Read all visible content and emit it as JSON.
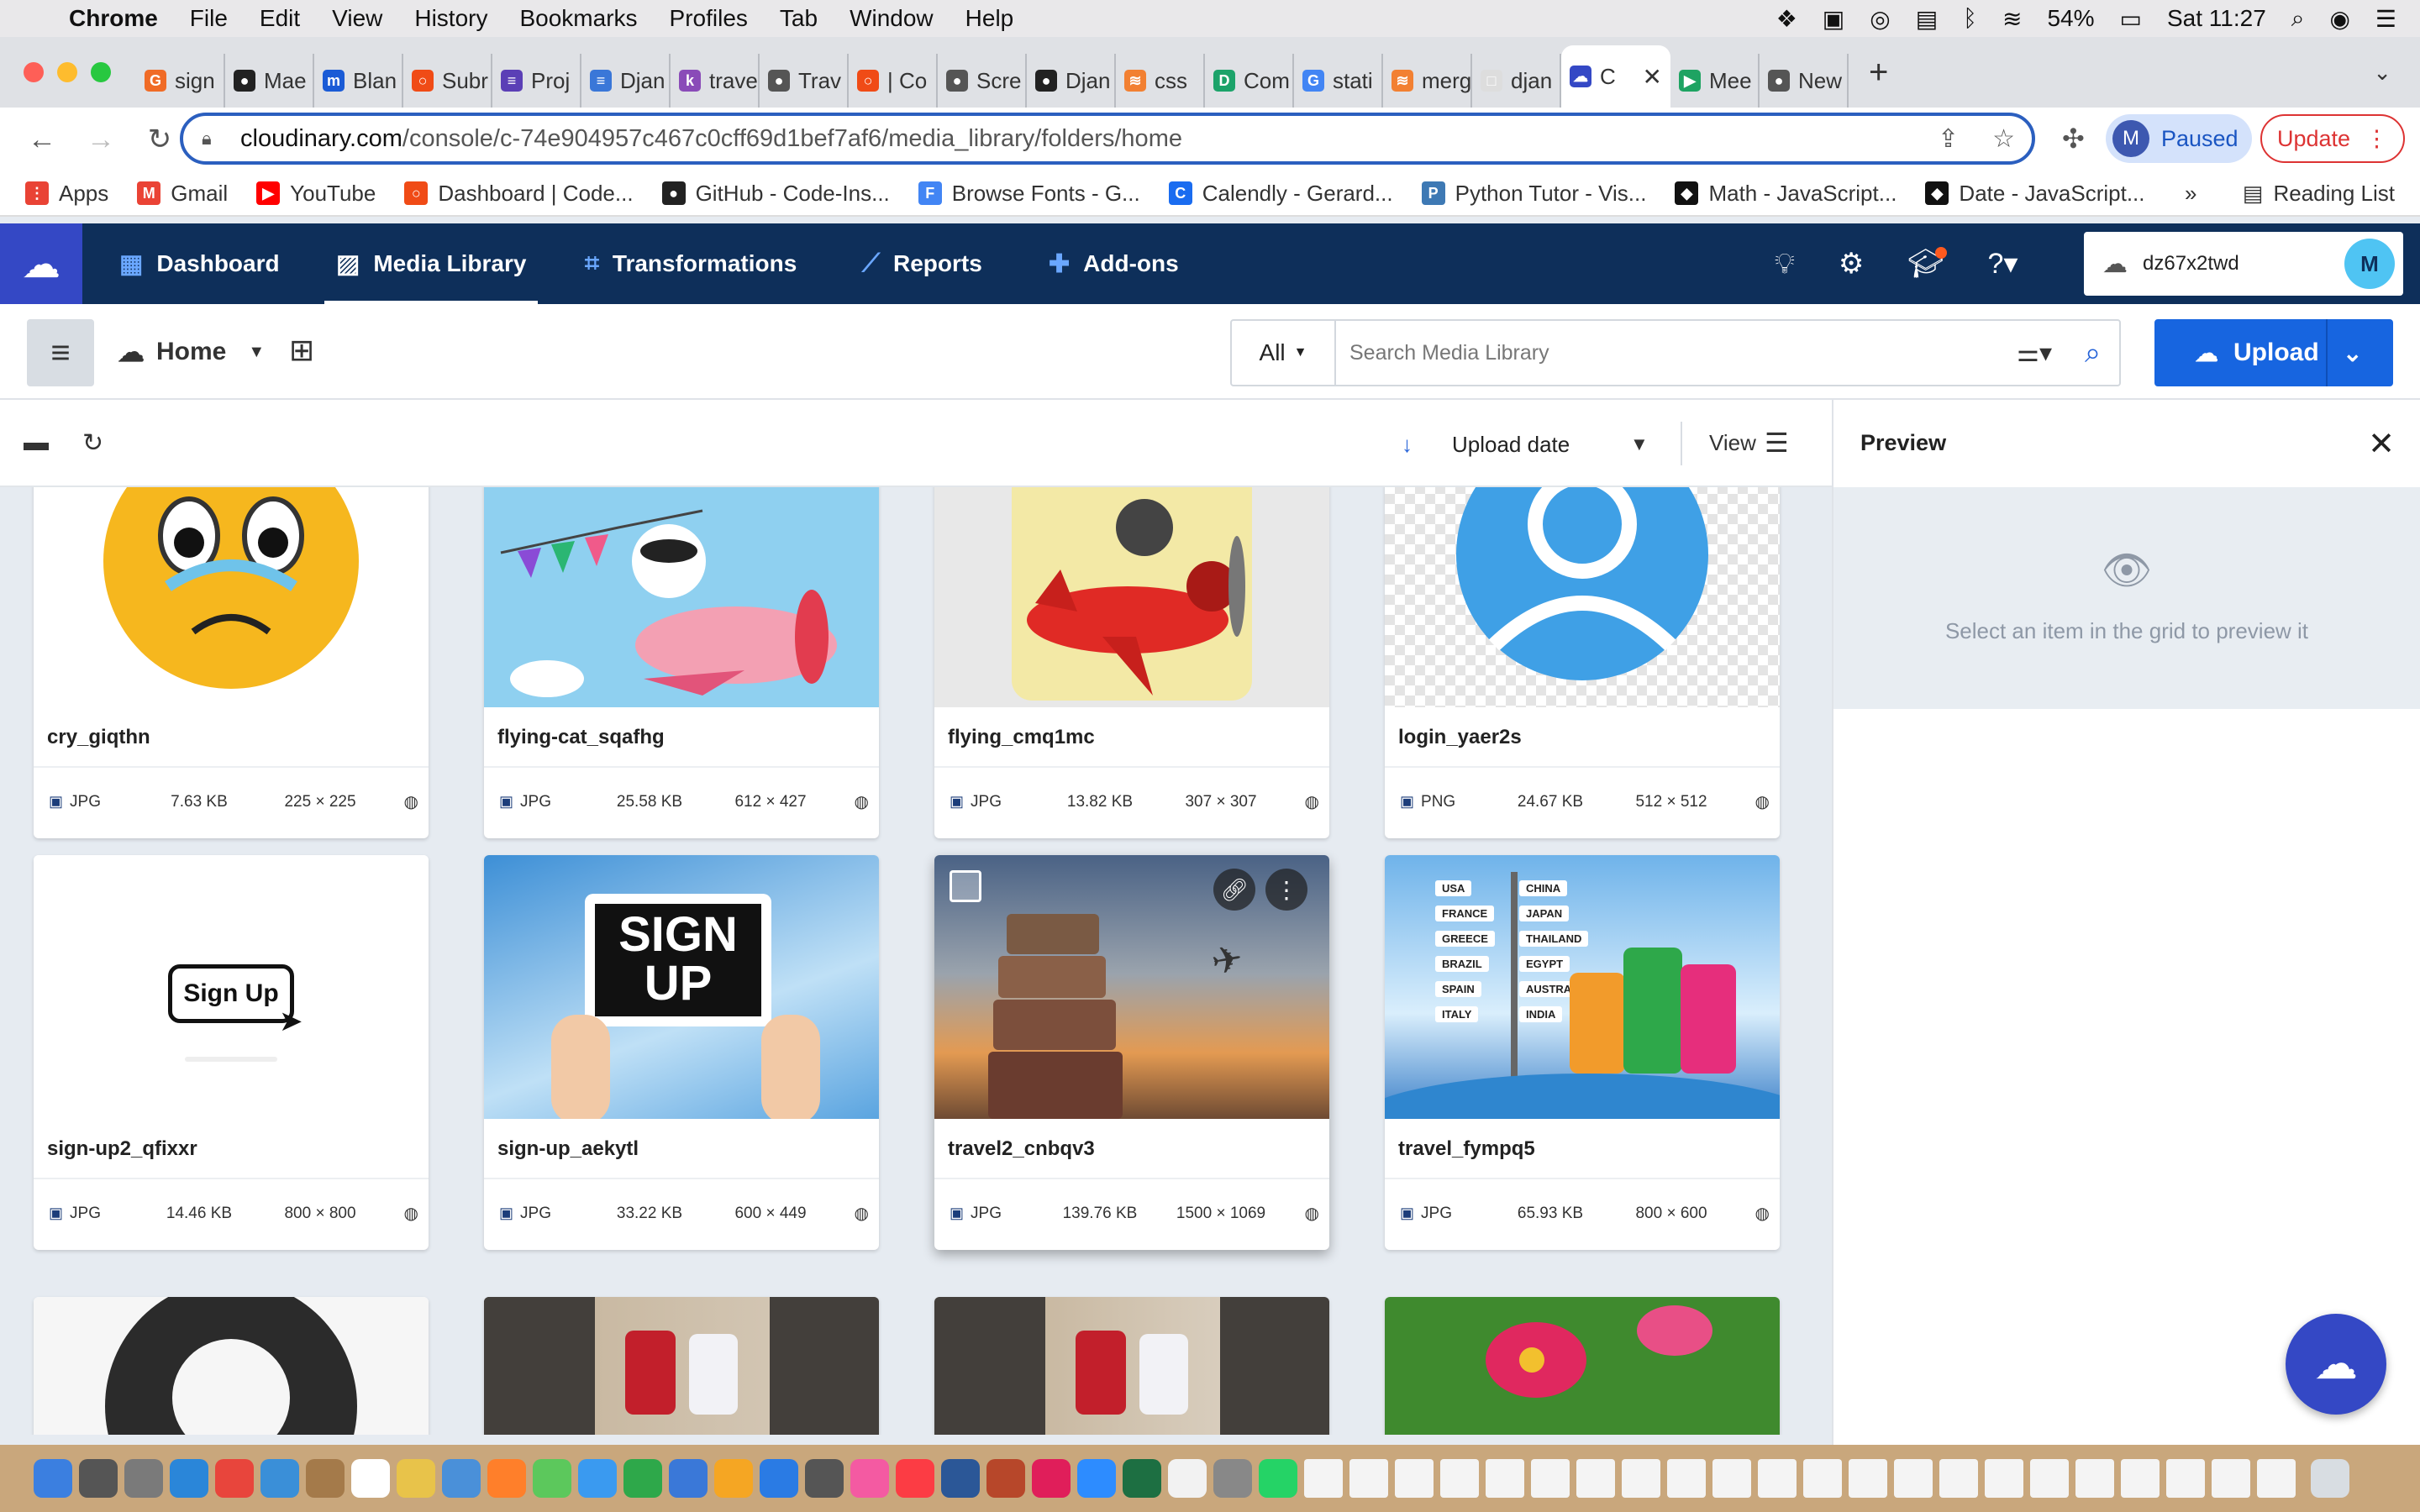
{
  "menubar": {
    "apple": "",
    "app": "Chrome",
    "items": [
      "File",
      "Edit",
      "View",
      "History",
      "Bookmarks",
      "Profiles",
      "Tab",
      "Window",
      "Help"
    ],
    "battery": "54%",
    "clock": "Sat 11:27"
  },
  "tabs": [
    {
      "label": "sign",
      "color": "#f06b26",
      "glyph": "G"
    },
    {
      "label": "Mae",
      "color": "#222222",
      "glyph": "●"
    },
    {
      "label": "Blan",
      "color": "#1a5bd6",
      "glyph": "m"
    },
    {
      "label": "Subr",
      "color": "#f04b16",
      "glyph": "○"
    },
    {
      "label": "Proj",
      "color": "#5b3fb6",
      "glyph": "≡"
    },
    {
      "label": "Djan",
      "color": "#3a77d8",
      "glyph": "≡"
    },
    {
      "label": "trave",
      "color": "#8a4bb8",
      "glyph": "k"
    },
    {
      "label": "Trav",
      "color": "#555555",
      "glyph": "●"
    },
    {
      "label": "| Co",
      "color": "#f04b16",
      "glyph": "○"
    },
    {
      "label": "Scre",
      "color": "#555555",
      "glyph": "●"
    },
    {
      "label": "Djan",
      "color": "#222222",
      "glyph": "●"
    },
    {
      "label": "css",
      "color": "#f28032",
      "glyph": "≋"
    },
    {
      "label": "Com",
      "color": "#1ca36a",
      "glyph": "D"
    },
    {
      "label": "stati",
      "color": "#4285f4",
      "glyph": "G"
    },
    {
      "label": "merg",
      "color": "#f28032",
      "glyph": "≋"
    },
    {
      "label": "djan",
      "color": "#dddddd",
      "glyph": "□"
    },
    {
      "label": "C",
      "color": "#3448c5",
      "glyph": "☁",
      "active": true
    },
    {
      "label": "Mee",
      "color": "#1ea362",
      "glyph": "▶"
    },
    {
      "label": "New",
      "color": "#555555",
      "glyph": "●"
    }
  ],
  "address": {
    "domain": "cloudinary.com",
    "path": "/console/c-74e904957c467c0cff69d1bef7af6/media_library/folders/home"
  },
  "profile": {
    "initial": "M",
    "label": "Paused"
  },
  "update_label": "Update",
  "bookmarks": [
    {
      "label": "Apps",
      "color": "#e94335",
      "glyph": "⋮"
    },
    {
      "label": "Gmail",
      "color": "#ea4335",
      "glyph": "M"
    },
    {
      "label": "YouTube",
      "color": "#ff0000",
      "glyph": "▶"
    },
    {
      "label": "Dashboard | Code...",
      "color": "#f04b16",
      "glyph": "○"
    },
    {
      "label": "GitHub - Code-Ins...",
      "color": "#222222",
      "glyph": "●"
    },
    {
      "label": "Browse Fonts - G...",
      "color": "#4285f4",
      "glyph": "F"
    },
    {
      "label": "Calendly - Gerard...",
      "color": "#1a6cf0",
      "glyph": "C"
    },
    {
      "label": "Python Tutor - Vis...",
      "color": "#3e79b4",
      "glyph": "P"
    },
    {
      "label": "Math - JavaScript...",
      "color": "#111111",
      "glyph": "◆"
    },
    {
      "label": "Date - JavaScript...",
      "color": "#111111",
      "glyph": "◆"
    }
  ],
  "bookmarks_overflow": "»",
  "reading_list": "Reading List",
  "nav": {
    "dashboard": "Dashboard",
    "media_library": "Media Library",
    "transformations": "Transformations",
    "reports": "Reports",
    "addons": "Add-ons",
    "cloud_name": "dz67x2twd",
    "avatar": "M"
  },
  "toolbar": {
    "home": "Home",
    "search_scope": "All",
    "search_placeholder": "Search Media Library",
    "upload": "Upload"
  },
  "sort": {
    "label": "Upload date",
    "view": "View"
  },
  "assets": [
    {
      "name": "cry_giqthn",
      "format": "JPG",
      "size": "7.63 KB",
      "dims": "225 × 225"
    },
    {
      "name": "flying-cat_sqafhg",
      "format": "JPG",
      "size": "25.58 KB",
      "dims": "612 × 427"
    },
    {
      "name": "flying_cmq1mc",
      "format": "JPG",
      "size": "13.82 KB",
      "dims": "307 × 307"
    },
    {
      "name": "login_yaer2s",
      "format": "PNG",
      "size": "24.67 KB",
      "dims": "512 × 512"
    },
    {
      "name": "sign-up2_qfixxr",
      "format": "JPG",
      "size": "14.46 KB",
      "dims": "800 × 800",
      "thumb_text": "Sign Up"
    },
    {
      "name": "sign-up_aekytl",
      "format": "JPG",
      "size": "33.22 KB",
      "dims": "600 × 449",
      "thumb_text_1": "SIGN",
      "thumb_text_2": "UP"
    },
    {
      "name": "travel2_cnbqv3",
      "format": "JPG",
      "size": "139.76 KB",
      "dims": "1500 × 1069"
    },
    {
      "name": "travel_fympq5",
      "format": "JPG",
      "size": "65.93 KB",
      "dims": "800 × 600",
      "signs": [
        "USA",
        "CHINA",
        "FRANCE",
        "JAPAN",
        "GREECE",
        "THAILAND",
        "BRAZIL",
        "EGYPT",
        "SPAIN",
        "AUSTRALIA",
        "ITALY",
        "INDIA"
      ]
    }
  ],
  "preview": {
    "title": "Preview",
    "message": "Select an item in the grid to preview it"
  },
  "colors": {
    "nav_bg": "#0e2f5a",
    "accent": "#1765e0",
    "logo": "#3448c5"
  }
}
